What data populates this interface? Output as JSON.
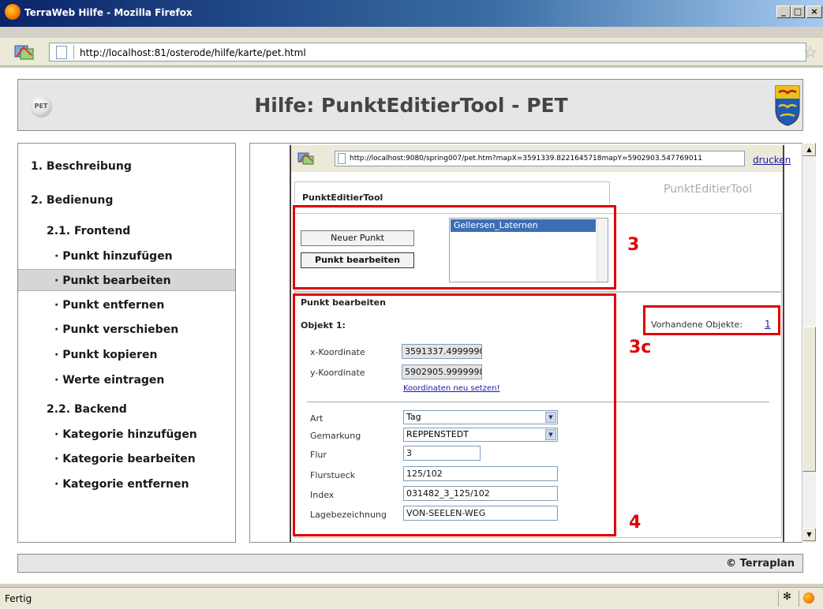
{
  "window": {
    "title": "TerraWeb Hilfe - Mozilla Firefox",
    "min_label": "_",
    "max_label": "□",
    "close_label": "×"
  },
  "browser": {
    "url": "http://localhost:81/osterode/hilfe/karte/pet.html",
    "status": "Fertig"
  },
  "header": {
    "logo_text": "PET",
    "title": "Hilfe: PunktEditierTool - PET"
  },
  "nav": {
    "items": [
      {
        "label": "1. Beschreibung",
        "level": 0
      },
      {
        "label": "2. Bedienung",
        "level": 0
      },
      {
        "label": "2.1. Frontend",
        "level": 1
      },
      {
        "label": "· Punkt hinzufügen",
        "level": 2
      },
      {
        "label": "· Punkt bearbeiten",
        "level": 2,
        "active": true
      },
      {
        "label": "· Punkt entfernen",
        "level": 2
      },
      {
        "label": "· Punkt verschieben",
        "level": 2
      },
      {
        "label": "· Punkt kopieren",
        "level": 2
      },
      {
        "label": "· Werte eintragen",
        "level": 2
      },
      {
        "label": "2.2. Backend",
        "level": 1
      },
      {
        "label": "· Kategorie hinzufügen",
        "level": 2
      },
      {
        "label": "· Kategorie bearbeiten",
        "level": 2
      },
      {
        "label": "· Kategorie entfernen",
        "level": 2
      }
    ]
  },
  "embed": {
    "url": "http://localhost:9080/spring007/pet.htm?mapX=3591339.8221645718mapY=5902903.547769011",
    "print_link": "drucken",
    "tab_title": "PunktEditierTool",
    "app_title": "PunktEditierTool",
    "buttons": {
      "new_point": "Neuer Punkt",
      "edit_point": "Punkt bearbeiten"
    },
    "list_selected": "Gellersen_Laternen",
    "edit_section_title": "Punkt bearbeiten",
    "object_label": "Objekt 1:",
    "existing_objects_label": "Vorhandene Objekte:",
    "existing_objects_count": "1",
    "x_label": "x-Koordinate",
    "x_value": "3591337.4999990",
    "y_label": "y-Koordinate",
    "y_value": "5902905.9999998",
    "reset_coords_link": "Koordinaten neu setzen!",
    "fields": {
      "art_label": "Art",
      "art_value": "Tag",
      "gemarkung_label": "Gemarkung",
      "gemarkung_value": "REPPENSTEDT",
      "flur_label": "Flur",
      "flur_value": "3",
      "flurstueck_label": "Flurstueck",
      "flurstueck_value": "125/102",
      "index_label": "Index",
      "index_value": "031482_3_125/102",
      "lage_label": "Lagebezeichnung",
      "lage_value": "VON-SEELEN-WEG"
    },
    "annotations": {
      "box3": "3",
      "box3c": "3c",
      "box4": "4"
    }
  },
  "footer": {
    "copyright": "© Terraplan"
  },
  "colors": {
    "annotation_red": "#e00000",
    "link_blue": "#1a1aa6"
  }
}
